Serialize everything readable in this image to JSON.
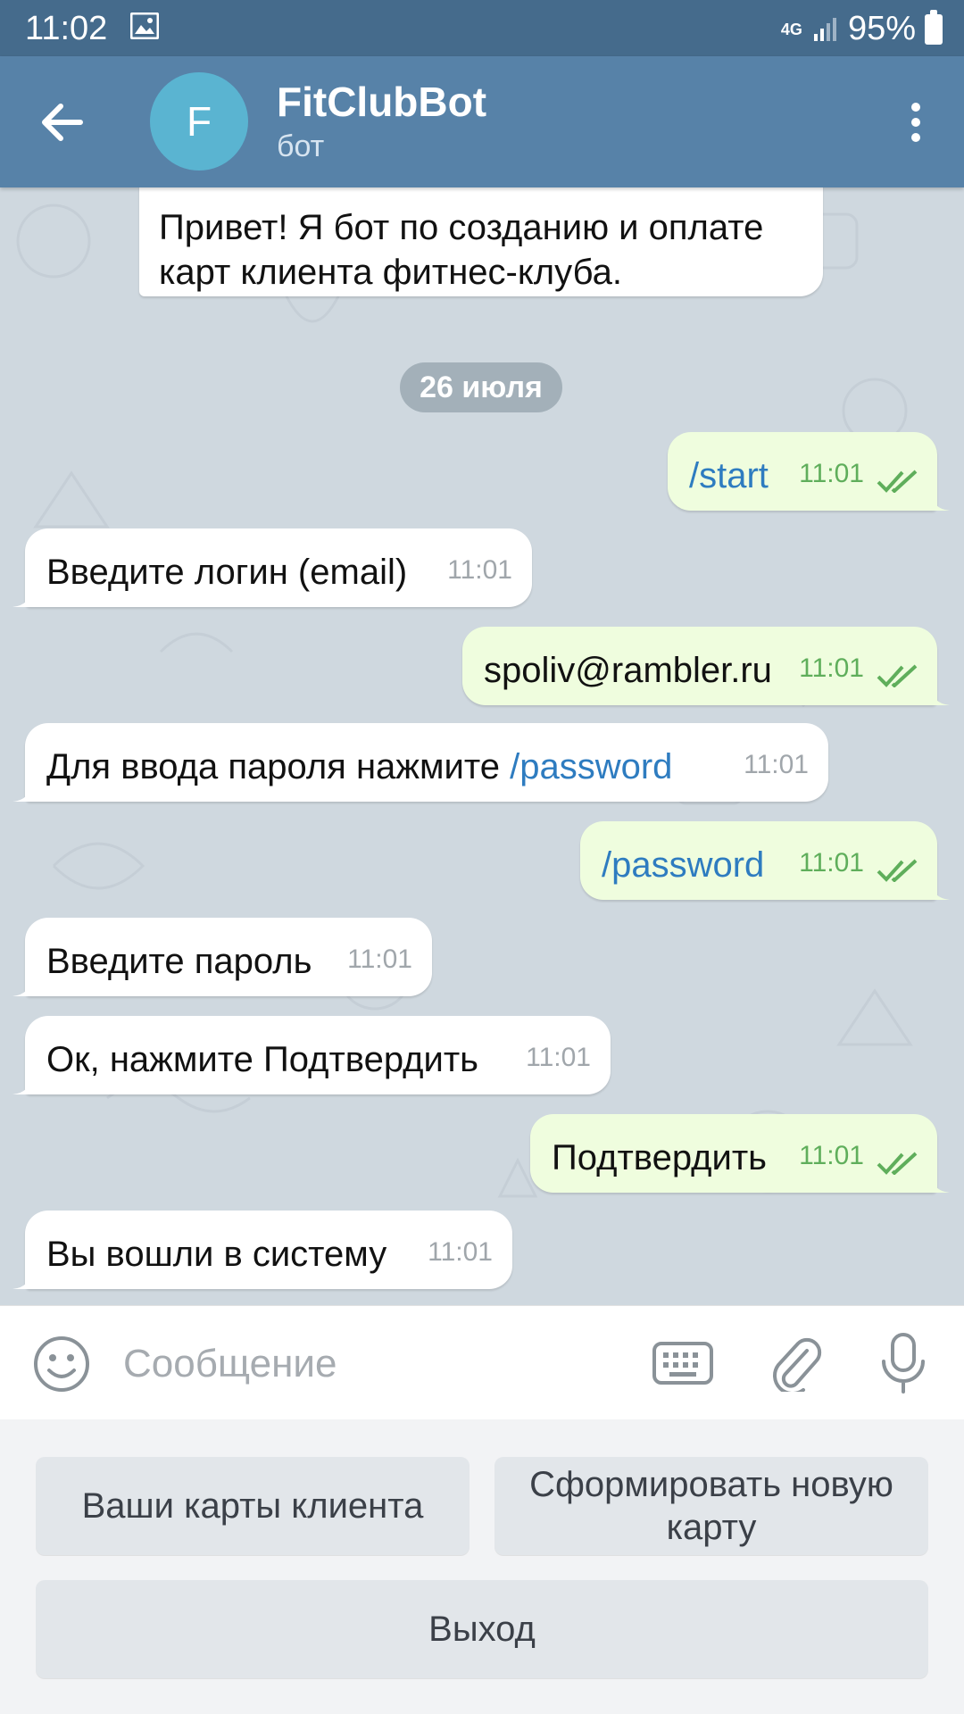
{
  "status_bar": {
    "time": "11:02",
    "network": "4G",
    "battery": "95%"
  },
  "header": {
    "avatar_letter": "F",
    "title": "FitClubBot",
    "subtitle": "бот"
  },
  "date_separator": "26 июля",
  "messages": [
    {
      "direction": "in",
      "text": "Привет! Я бот по созданию и оплате",
      "text2": "карт клиента фитнес-клуба."
    },
    {
      "direction": "out",
      "text": "/start",
      "time": "11:01"
    },
    {
      "direction": "in",
      "text": "Введите логин (email)",
      "time": "11:01"
    },
    {
      "direction": "out",
      "text": "spoliv@rambler.ru",
      "time": "11:01"
    },
    {
      "direction": "in",
      "text": "Для ввода пароля нажмите ",
      "link": "/password",
      "time": "11:01"
    },
    {
      "direction": "out",
      "text": "/password",
      "time": "11:01"
    },
    {
      "direction": "in",
      "text": "Введите пароль",
      "time": "11:01"
    },
    {
      "direction": "in",
      "text": "Ок, нажмите Подтвердить",
      "time": "11:01"
    },
    {
      "direction": "out",
      "text": "Подтвердить",
      "time": "11:01"
    },
    {
      "direction": "in",
      "text": "Вы вошли в систему",
      "time": "11:01"
    }
  ],
  "input": {
    "placeholder": "Сообщение"
  },
  "bot_keyboard": {
    "cards_button": "Ваши карты клиента",
    "new_card_line1": "Сформировать новую",
    "new_card_line2": "карту",
    "exit_button": "Выход"
  },
  "colors": {
    "header": "#5782a8",
    "status_bar": "#456b8c",
    "outgoing_bubble": "#effdde",
    "link": "#2e7cc0",
    "read_checks": "#5fae5b"
  }
}
